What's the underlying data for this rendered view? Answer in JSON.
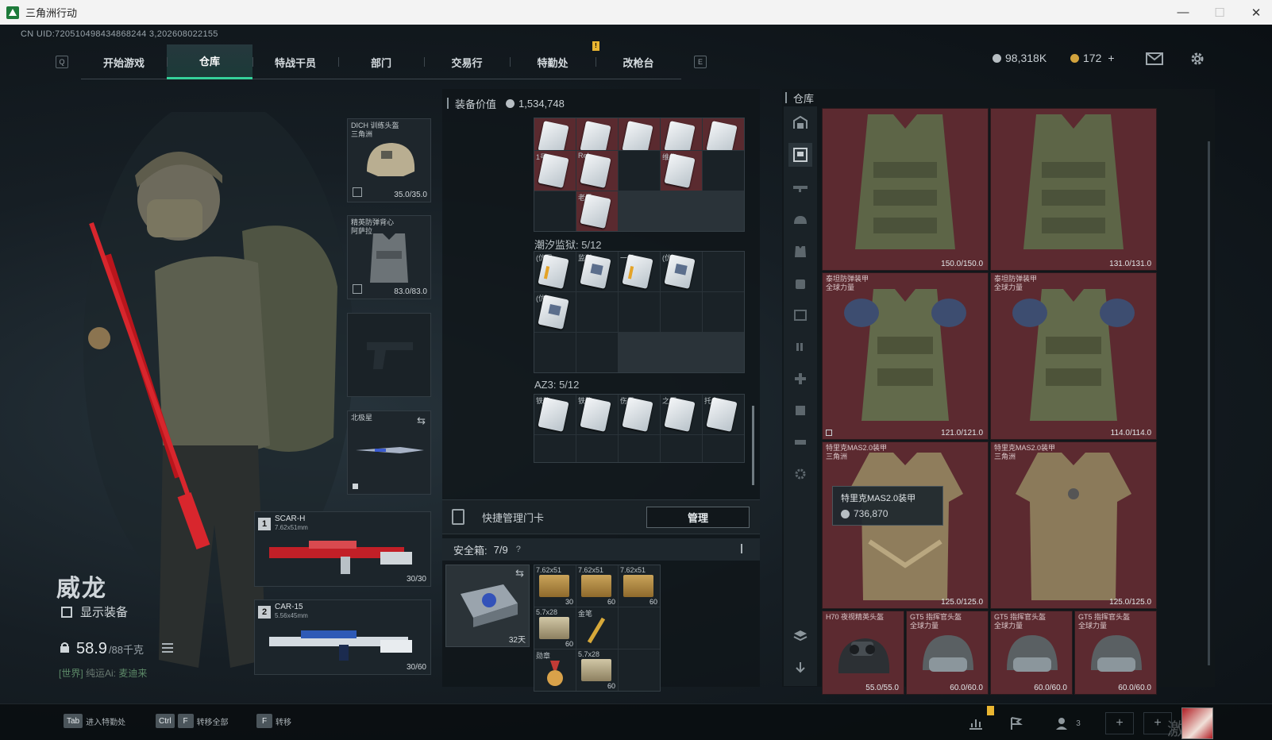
{
  "window": {
    "title": "三角洲行动",
    "controls": [
      "—",
      "☐",
      "✕"
    ]
  },
  "uid_line": "CN UID:720510498434868244 3,202608022155",
  "nav": {
    "left_key": "Q",
    "right_key": "E",
    "tabs": [
      {
        "label": "开始游戏"
      },
      {
        "label": "仓库"
      },
      {
        "label": "特战干员"
      },
      {
        "label": "部门"
      },
      {
        "label": "交易行"
      },
      {
        "label": "特勤处"
      },
      {
        "label": "改枪台"
      }
    ],
    "active_tab": "仓库",
    "notif_badge": "!"
  },
  "currency": {
    "coins": "98,318K",
    "bonds": "172",
    "add": "+"
  },
  "operator": {
    "name": "威龙",
    "show_equipment": "显示装备",
    "weight": "58.9",
    "weight_max": "/88千克"
  },
  "chat": {
    "channel": "[世界]",
    "user": "纯运Ai:",
    "message": "麦迪来"
  },
  "slots": {
    "helmet": {
      "label": "DICH 训练头盔",
      "sublabel": "三角洲",
      "durability": "35.0/35.0"
    },
    "armor": {
      "label": "精英防弹背心",
      "sublabel": "阿萨拉",
      "durability": "83.0/83.0"
    },
    "melee": {
      "label": "北极星"
    },
    "weapon1": {
      "index": "1",
      "name": "SCAR-H",
      "caliber": "7.62x51mm",
      "ammo": "30/30"
    },
    "weapon2": {
      "index": "2",
      "name": "CAR-15",
      "caliber": "5.56x45mm",
      "ammo": "30/60"
    }
  },
  "equipment_value": {
    "label": "装备价值",
    "value": "1,534,748"
  },
  "card_sections": {
    "top_labels": [
      "1号",
      "Rel...",
      "维修"
    ],
    "top_bottom_label": "老汤",
    "tidal": {
      "title": "潮汐监狱: 5/12",
      "labels": [
        "(仿星",
        "监狱",
        "一级",
        "(仿",
        "(仿"
      ]
    },
    "az3": {
      "title": "AZ3: 5/12",
      "labels": [
        "铁路",
        "铁路",
        "伤星",
        "之烟",
        "托卡"
      ]
    }
  },
  "keycard": {
    "label": "快捷管理门卡",
    "manage": "管理"
  },
  "safebox": {
    "label": "安全箱:",
    "count": "7/9",
    "help": "?",
    "days": "32天",
    "items": [
      {
        "label": "7.62x51",
        "count": "30"
      },
      {
        "label": "7.62x51",
        "count": "60"
      },
      {
        "label": "7.62x51",
        "count": "60"
      },
      {
        "label": "5.7x28",
        "count": "60"
      },
      {
        "label": "金笔",
        "count": ""
      },
      {
        "label": "勋章",
        "count": ""
      },
      {
        "label": "5.7x28",
        "count": "60"
      }
    ]
  },
  "warehouse": {
    "title": "仓库",
    "items": [
      {
        "label": "",
        "sub": "",
        "durability": "150.0/150.0"
      },
      {
        "label": "",
        "sub": "",
        "durability": "131.0/131.0"
      },
      {
        "label": "泰坦防弹装甲",
        "sub": "全球力量",
        "durability": "121.0/121.0"
      },
      {
        "label": "泰坦防弹装甲",
        "sub": "全球力量",
        "durability": "114.0/114.0"
      },
      {
        "label": "特里克MAS2.0装甲",
        "sub": "三角洲",
        "durability": "125.0/125.0"
      },
      {
        "label": "特里克MAS2.0装甲",
        "sub": "三角洲",
        "durability": "125.0/125.0"
      },
      {
        "label": "H70 夜视精英头盔",
        "sub": "",
        "durability": "55.0/55.0"
      },
      {
        "label": "GT5 指挥官头盔",
        "sub": "全球力量",
        "durability": "60.0/60.0"
      },
      {
        "label": "GT5 指挥官头盔",
        "sub": "全球力量",
        "durability": "60.0/60.0"
      },
      {
        "label": "GT5 指挥官头盔",
        "sub": "全球力量",
        "durability": "60.0/60.0"
      }
    ],
    "tooltip": {
      "name": "特里克MAS2.0装甲",
      "price": "736,870"
    }
  },
  "bottom": {
    "hints": [
      {
        "key": "Tab",
        "label": "进入特勤处"
      },
      {
        "key": "Ctrl",
        "key2": "F",
        "label": "转移全部"
      },
      {
        "key": "F",
        "label": "转移"
      }
    ],
    "squad_count": "3",
    "watermark": "激活 Windows"
  },
  "colors": {
    "accent": "#35d19a",
    "item_bg": "#5c2a30",
    "panel_bg": "#10161a"
  }
}
